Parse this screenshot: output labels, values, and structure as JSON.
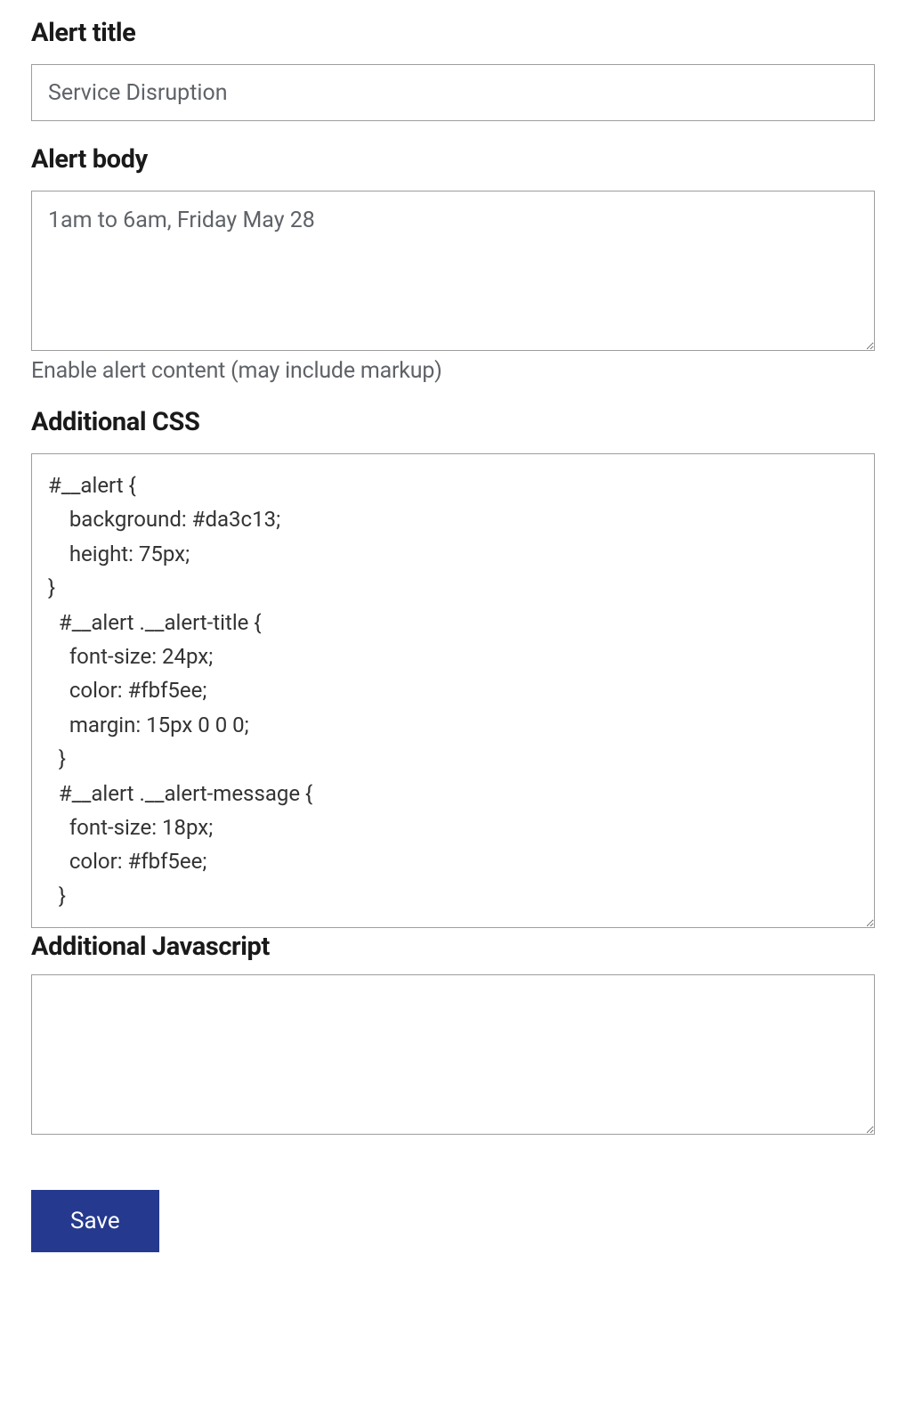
{
  "fields": {
    "alert_title": {
      "label": "Alert title",
      "value": "Service Disruption"
    },
    "alert_body": {
      "label": "Alert body",
      "value": "1am to 6am, Friday May 28",
      "help": "Enable alert content (may include markup)"
    },
    "additional_css": {
      "label": "Additional CSS",
      "value": "#__alert {\n    background: #da3c13;\n    height: 75px;\n}\n  #__alert .__alert-title {\n    font-size: 24px;\n    color: #fbf5ee;\n    margin: 15px 0 0 0;\n  }\n  #__alert .__alert-message {\n    font-size: 18px;\n    color: #fbf5ee;\n  }"
    },
    "additional_js": {
      "label": "Additional Javascript",
      "value": ""
    }
  },
  "buttons": {
    "save": "Save"
  }
}
